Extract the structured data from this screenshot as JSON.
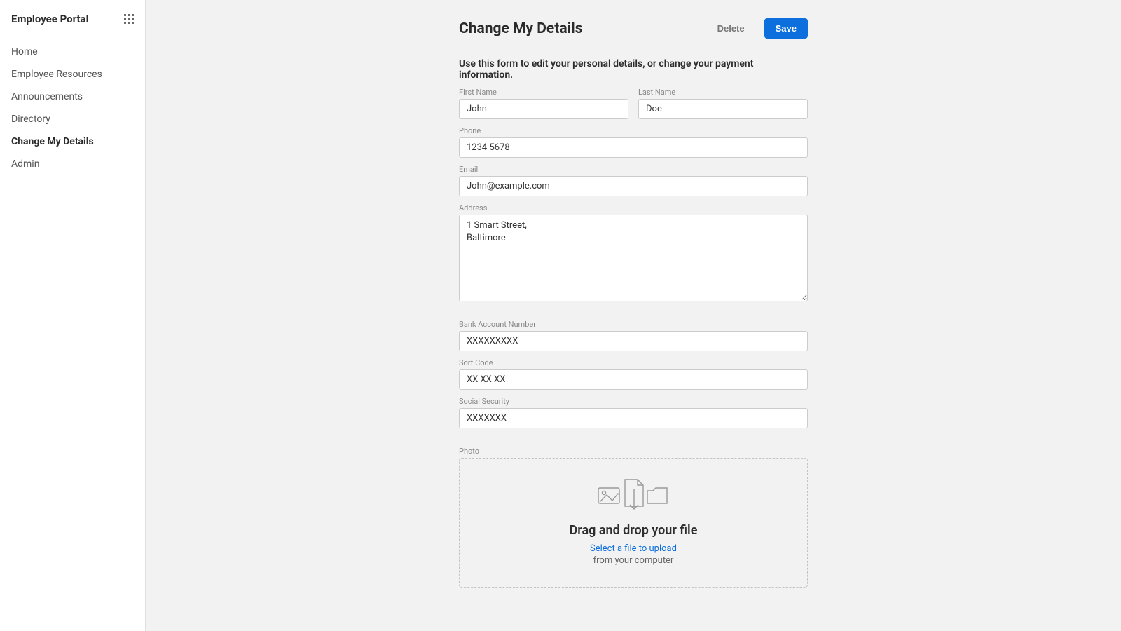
{
  "sidebar": {
    "title": "Employee Portal",
    "nav": [
      {
        "label": "Home"
      },
      {
        "label": "Employee Resources"
      },
      {
        "label": "Announcements"
      },
      {
        "label": "Directory"
      },
      {
        "label": "Change My Details"
      },
      {
        "label": "Admin"
      }
    ]
  },
  "page": {
    "title": "Change My Details",
    "description": "Use this form to edit your personal details, or change your payment information.",
    "actions": {
      "delete": "Delete",
      "save": "Save"
    }
  },
  "form": {
    "first_name": {
      "label": "First Name",
      "value": "John"
    },
    "last_name": {
      "label": "Last Name",
      "value": "Doe"
    },
    "phone": {
      "label": "Phone",
      "value": "1234 5678"
    },
    "email": {
      "label": "Email",
      "value": "John@example.com"
    },
    "address": {
      "label": "Address",
      "value": "1 Smart Street,\nBaltimore"
    },
    "bank_account": {
      "label": "Bank Account Number",
      "value": "XXXXXXXXX"
    },
    "sort_code": {
      "label": "Sort Code",
      "value": "XX XX XX"
    },
    "social_security": {
      "label": "Social Security",
      "value": "XXXXXXX"
    },
    "photo": {
      "label": "Photo",
      "dropzone": {
        "title": "Drag and drop your file",
        "link": "Select a file to upload",
        "sub": "from your computer"
      }
    }
  }
}
